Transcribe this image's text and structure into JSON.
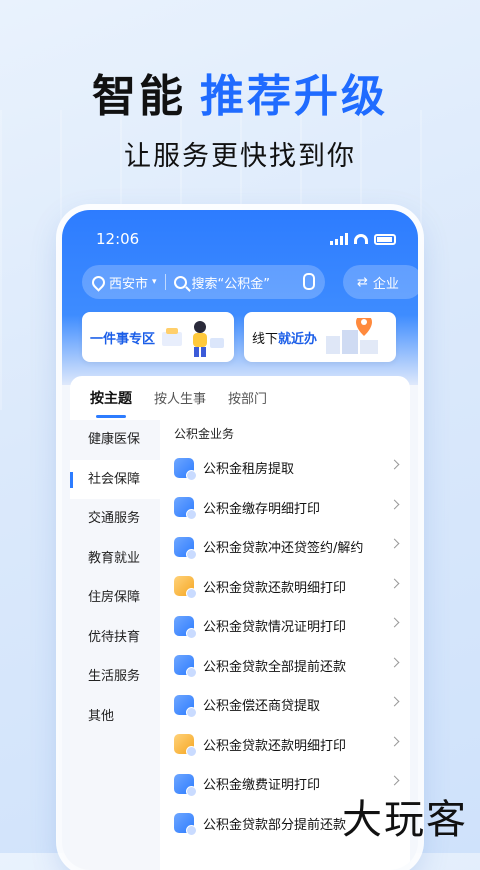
{
  "headline": {
    "part1": "智能",
    "part2": "推荐升级"
  },
  "subline": "让服务更快找到你",
  "status": {
    "time": "12:06"
  },
  "search": {
    "city": "西安市",
    "placeholder": "搜索“公积金”"
  },
  "corp_label": "企业",
  "cards": [
    {
      "label_plain": "",
      "label_bold": "一件事专区"
    },
    {
      "label_plain": "线下",
      "label_bold": "就近办"
    }
  ],
  "tabs": [
    "按主题",
    "按人生事",
    "按部门"
  ],
  "categories": [
    "健康医保",
    "社会保障",
    "交通服务",
    "教育就业",
    "住房保障",
    "优待扶育",
    "生活服务",
    "其他"
  ],
  "section_title": "公积金业务",
  "items": [
    "公积金租房提取",
    "公积金缴存明细打印",
    "公积金贷款冲还贷签约/解约",
    "公积金贷款还款明细打印",
    "公积金贷款情况证明打印",
    "公积金贷款全部提前还款",
    "公积金偿还商贷提取",
    "公积金贷款还款明细打印",
    "公积金缴费证明打印",
    "公积金贷款部分提前还款"
  ],
  "watermark": "大玩客",
  "colors": {
    "accent": "#2d7cff",
    "headline_blue": "#1f6bff"
  }
}
